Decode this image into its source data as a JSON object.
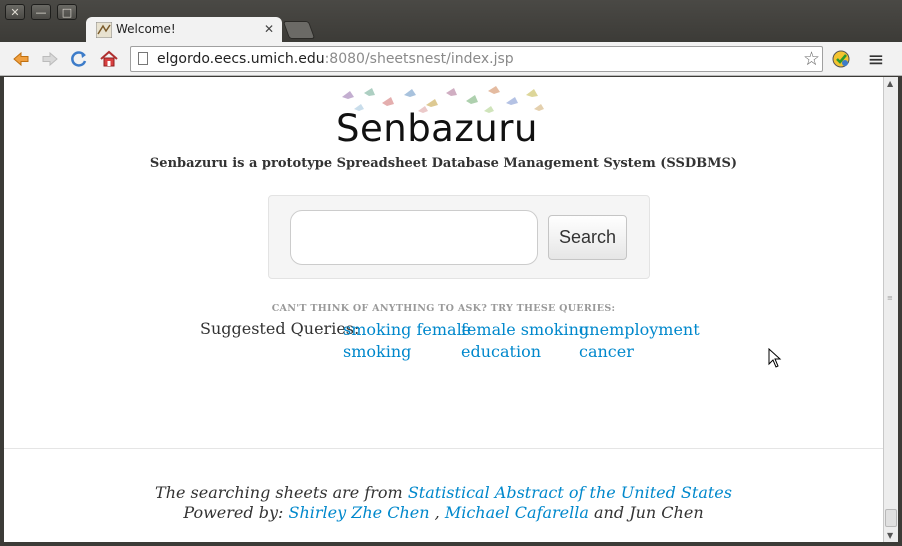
{
  "window": {
    "close_glyph": "✕",
    "minimize_glyph": "—",
    "maximize_glyph": "□"
  },
  "tab": {
    "title": "Welcome!",
    "close_glyph": "✕"
  },
  "toolbar": {
    "back_icon": "back-arrow-icon",
    "forward_icon": "forward-arrow-icon",
    "reload_icon": "reload-icon",
    "home_icon": "home-icon",
    "url_host": "elgordo.eecs.umich.edu",
    "url_rest": ":8080/sheetsnest/index.jsp",
    "star_glyph": "☆",
    "menu_glyph": "≡"
  },
  "page": {
    "logo_text": "Senbazuru",
    "tagline": "Senbazuru is a prototype Spreadsheet Database Management System (SSDBMS)",
    "search": {
      "value": "",
      "placeholder": "",
      "button_label": "Search"
    },
    "hint": "CAN'T THINK OF ANYTHING TO ASK? TRY THESE QUERIES:",
    "suggested_label": "Suggested Queries:",
    "suggested_queries": [
      {
        "line1": "smoking female",
        "line2": "smoking"
      },
      {
        "line1": "female smoking",
        "line2": "education"
      },
      {
        "line1": "unemployment",
        "line2": "cancer"
      }
    ],
    "footer": {
      "line1_prefix": "The searching sheets are from",
      "line1_link": "Statistical Abstract of the United States",
      "line2_prefix": "Powered by:",
      "author1": "Shirley Zhe Chen",
      "sep": ",",
      "author2": "Michael Cafarella",
      "suffix": "and Jun Chen"
    }
  },
  "colors": {
    "link": "#0088cc",
    "chrome_dark": "#3c3b37",
    "toolbar": "#f2f2f2"
  }
}
